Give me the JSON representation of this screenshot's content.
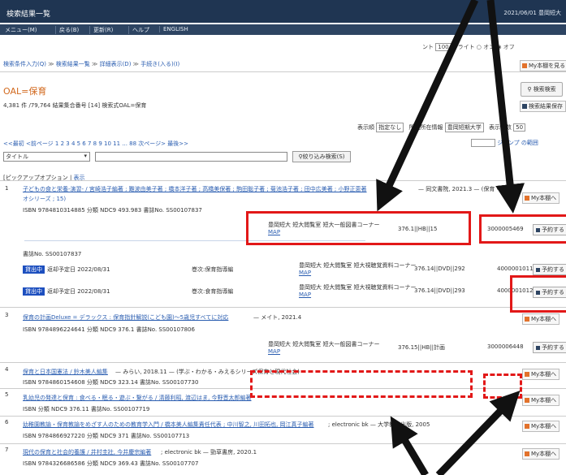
{
  "window": {
    "title": "検索結果一覧",
    "datetime": "2021/06/01 豊岡短大"
  },
  "menu": [
    "メニュー(M)",
    "戻る(B)",
    "更新(R)",
    "ヘルプ",
    "ENGLISH"
  ],
  "toolbar": {
    "count_label": "ント",
    "count_value": "100",
    "light_label": "ライト",
    "on_label": "オン",
    "off_label": "オフ"
  },
  "breadcrumb": [
    "検索条件入力(Q)",
    "検索結果一覧",
    "詳細表示(D)",
    "手続き(入る)(I)"
  ],
  "my_list_button": "My本棚を見る",
  "query": "OAL=保育",
  "summary": "4,381 件 /79,764  結果集合番号 [14]  検索式OAL=保育",
  "detail_search_button": "検索検索",
  "save_result_button": "検索結果保存",
  "sort": {
    "label": "表示順",
    "value": "指定なし",
    "location_label": "所蔵所在情報",
    "location_value": "豊岡短期大学",
    "count_label": "表示件数",
    "count_value": "50"
  },
  "pager": "<<最初 <前ページ 1 2 3 4 5 6 7 8 9 10 11 ... 88 次ページ> 最後>>",
  "jump": {
    "label": "ジャンプ",
    "link": "の範囲"
  },
  "field_select": "タイトル",
  "refine_button": "絞り込み検索(S)",
  "pickup": {
    "label": "ピックアップオプション",
    "show": "表示"
  },
  "records": [
    {
      "num": "1",
      "title": "子どもの食と栄養-演習- / 宮崎浩子編著 ; 難波由美子著 ; 橋本洋子著 ; 高橋美保著 ; 駒田聡子著 ; 菊池浩子著 ; 田中広美著 ; 小野正恵著",
      "title2": "オシリーズ ; 15)",
      "tail": "— 同文書院, 2021.3 — (保育・教",
      "meta": "ISBN 9784810314885  分類 NDC9 493.983  書誌No. SS00107837"
    },
    {
      "num": "3",
      "title": "保育の計画Deluxe = デラックス : 保育指針解説(こども園)～5歳児すべてに対応",
      "tail": "— メイト, 2021.4",
      "meta": "ISBN 9784896224641  分類 NDC9 376.1  書誌No. SS00107806"
    },
    {
      "num": "4",
      "title": "保育と日本国憲法 / 鈴木美人編集",
      "tail": "— みらい, 2018.11 — (学ぶ・わかる・みえるシリーズ保育と現代社会)",
      "meta": "ISBN 9784860154608  分類 NDC9 323.14  書誌No. SS00107730"
    },
    {
      "num": "5",
      "title": "乳幼児の発達と保育 : 食べる・眠る・遊ぶ・繋がる / 清藤利昭, 渡辺はま, 今野晋太郎編著",
      "tail": "",
      "meta": "ISBN  分類 NDC9 376.11  書誌No. SS00107719"
    },
    {
      "num": "6",
      "title": "幼稚園教諭・保育教諭をめざす人のための教育学入門 / 橋本美人編集責任代表 ; 中川智之, 川田拓也, 岡江真子編著",
      "tail": "; electronic bk — 大学教育出版, 2005",
      "meta": "ISBN 9784866927220  分類 NDC9 371  書誌No. SS00107713"
    },
    {
      "num": "7",
      "title": "現代の保育と社会的養護 / 井村圭壯, 今井慶宗編著",
      "tail": "; electronic bk — 勁草書房, 2020.1",
      "meta": "ISBN 9784326686586  分類 NDC9 369.43  書誌No. SS00107707"
    }
  ],
  "holdings": {
    "r1": {
      "location": "豊岡短大 短大閲覧室 短大一般図書コーナー",
      "map": "MAP",
      "callno": "376.1||HB||15",
      "regno": "3000005469"
    },
    "r1b": {
      "meta": "書誌No. SS00107837"
    },
    "r2a": {
      "status": "貸出中",
      "due": "返却予定日 2022/08/31",
      "vol": "巻次:保育指導編",
      "location": "豊岡短大 短大閲覧室 短大視聴覚資料コーナー",
      "map": "MAP",
      "callno": "376.14||DVD||292",
      "regno": "4000001011"
    },
    "r2b": {
      "status": "貸出中",
      "due": "返却予定日 2022/08/31",
      "vol": "巻次:食育指導編",
      "location": "豊岡短大 短大閲覧室 短大視聴覚資料コーナー",
      "map": "MAP",
      "callno": "376.14||DVD||293",
      "regno": "4000001012"
    },
    "r3": {
      "location": "豊岡短大 短大閲覧室 短大一般図書コーナー",
      "map": "MAP",
      "callno": "376.15||HB||計画",
      "regno": "3000006448"
    }
  },
  "reserve_label": "予約する",
  "my_label": "My本棚へ"
}
